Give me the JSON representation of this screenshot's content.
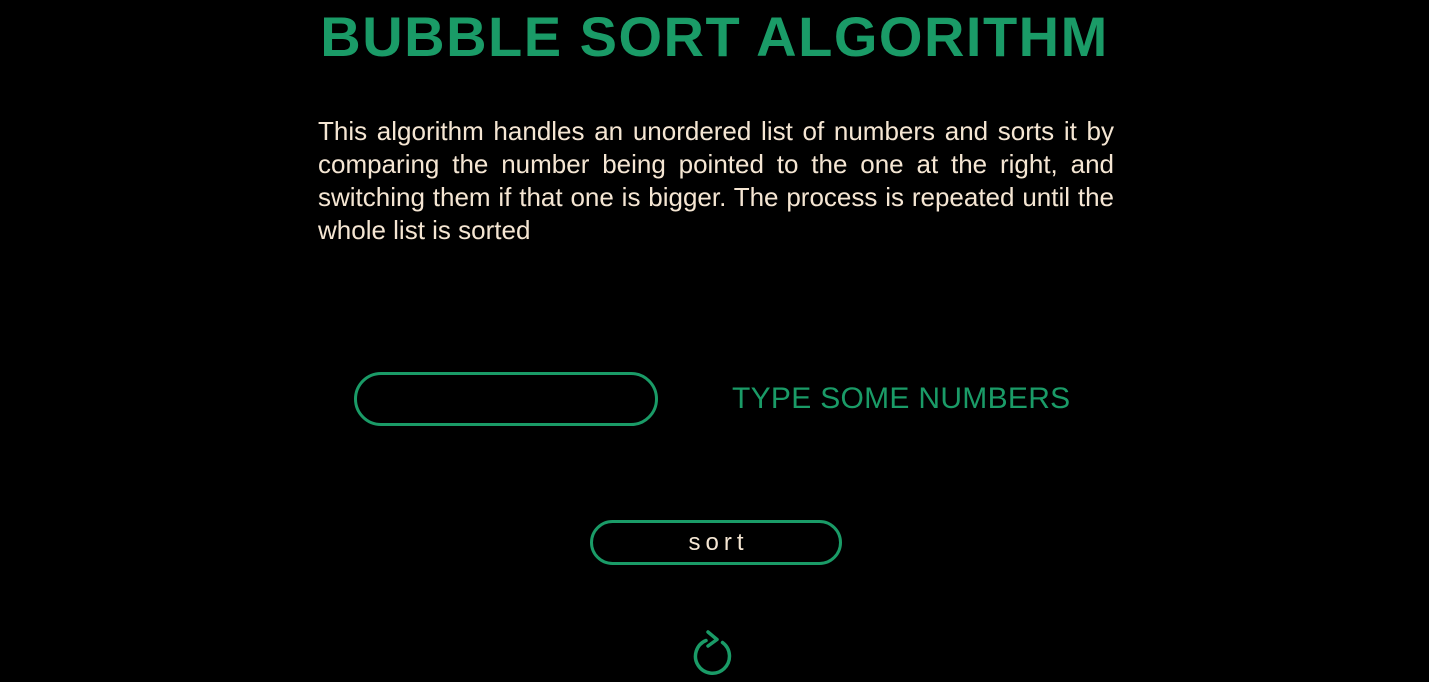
{
  "page": {
    "title": "BUBBLE SORT ALGORITHM",
    "description": "This algorithm handles an unordered list of numbers and sorts it by comparing the number being pointed to the one at the right, and switching them if that one is bigger. The process is repeated until the whole list is sorted"
  },
  "form": {
    "input_value": "",
    "input_placeholder": "",
    "input_label": "TYPE SOME NUMBERS",
    "sort_label": "sort",
    "reset_icon": "reset-icon"
  },
  "colors": {
    "background": "#000000",
    "accent": "#1a9b67",
    "text": "#f5e6d3"
  }
}
